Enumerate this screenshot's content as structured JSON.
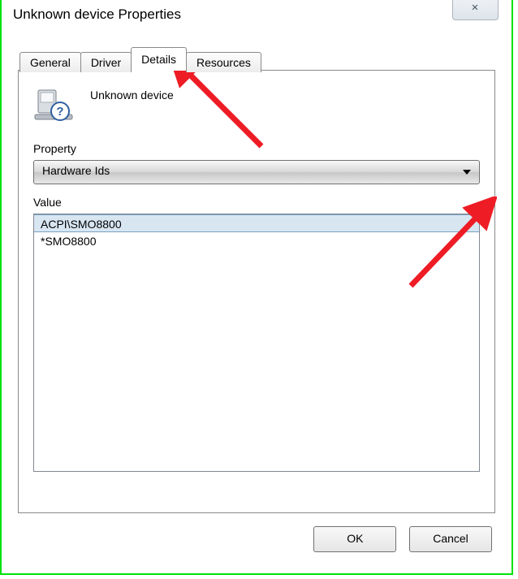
{
  "window": {
    "title": "Unknown device Properties",
    "close_glyph": "✕"
  },
  "tabs": {
    "t0": "General",
    "t1": "Driver",
    "t2": "Details",
    "t3": "Resources"
  },
  "device": {
    "name": "Unknown device"
  },
  "property": {
    "label": "Property",
    "selected": "Hardware Ids"
  },
  "value": {
    "label": "Value",
    "rows": {
      "r0": "ACPI\\SMO8800",
      "r1": "*SMO8800"
    }
  },
  "buttons": {
    "ok": "OK",
    "cancel": "Cancel"
  }
}
